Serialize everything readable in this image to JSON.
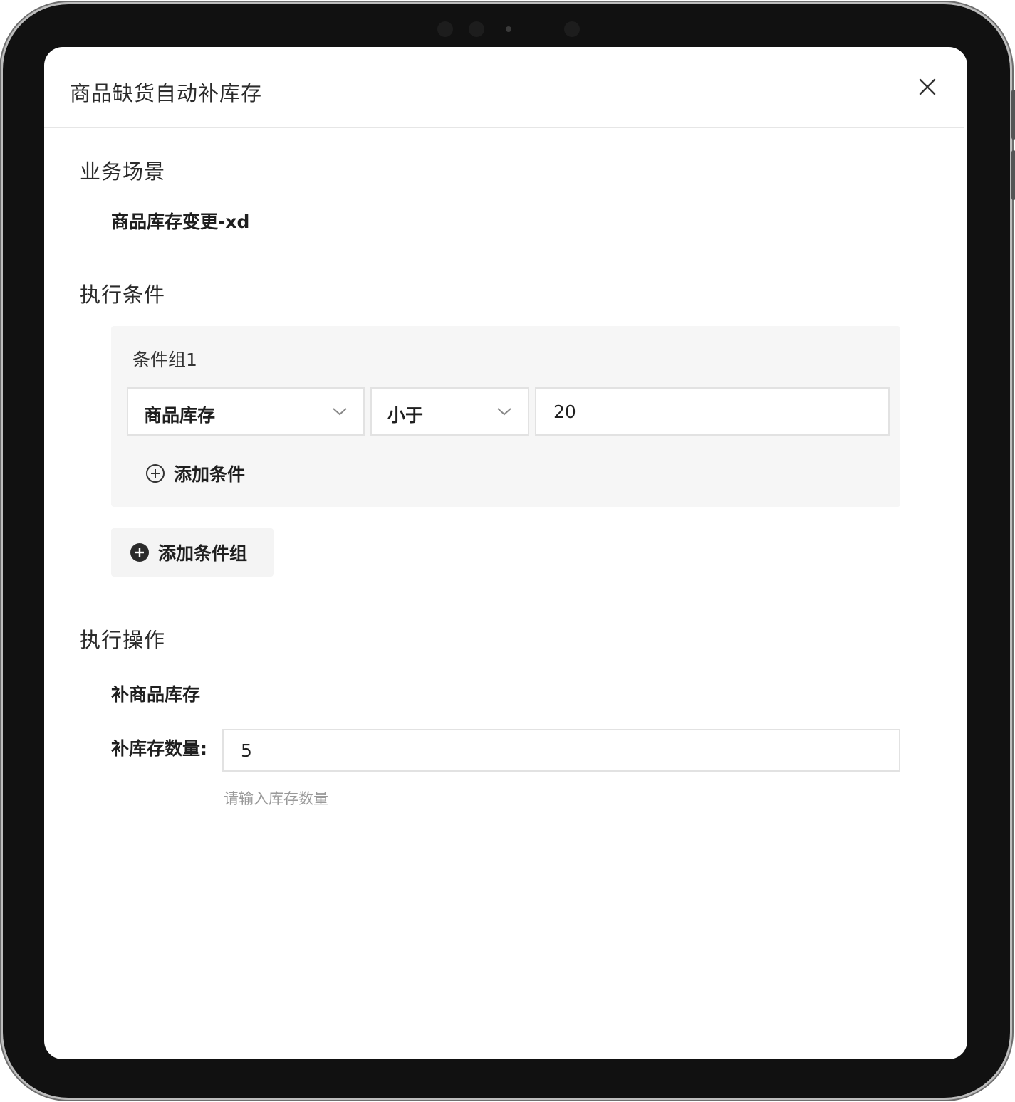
{
  "modal": {
    "title": "商品缺货自动补库存"
  },
  "business_scene": {
    "heading": "业务场景",
    "value": "商品库存变更-xd"
  },
  "conditions": {
    "heading": "执行条件",
    "groups": [
      {
        "label": "条件组1",
        "field": "商品库存",
        "operator": "小于",
        "value": "20",
        "add_condition_label": "添加条件"
      }
    ],
    "add_group_label": "添加条件组"
  },
  "operation": {
    "heading": "执行操作",
    "action": "补商品库存",
    "quantity_label": "补库存数量:",
    "quantity_value": "5",
    "quantity_hint": "请输入库存数量"
  },
  "icons": {
    "close": "close-icon",
    "chevron": "chevron-down-icon",
    "add_outline": "plus-circle-outline-icon",
    "add_filled": "plus-circle-filled-icon"
  }
}
